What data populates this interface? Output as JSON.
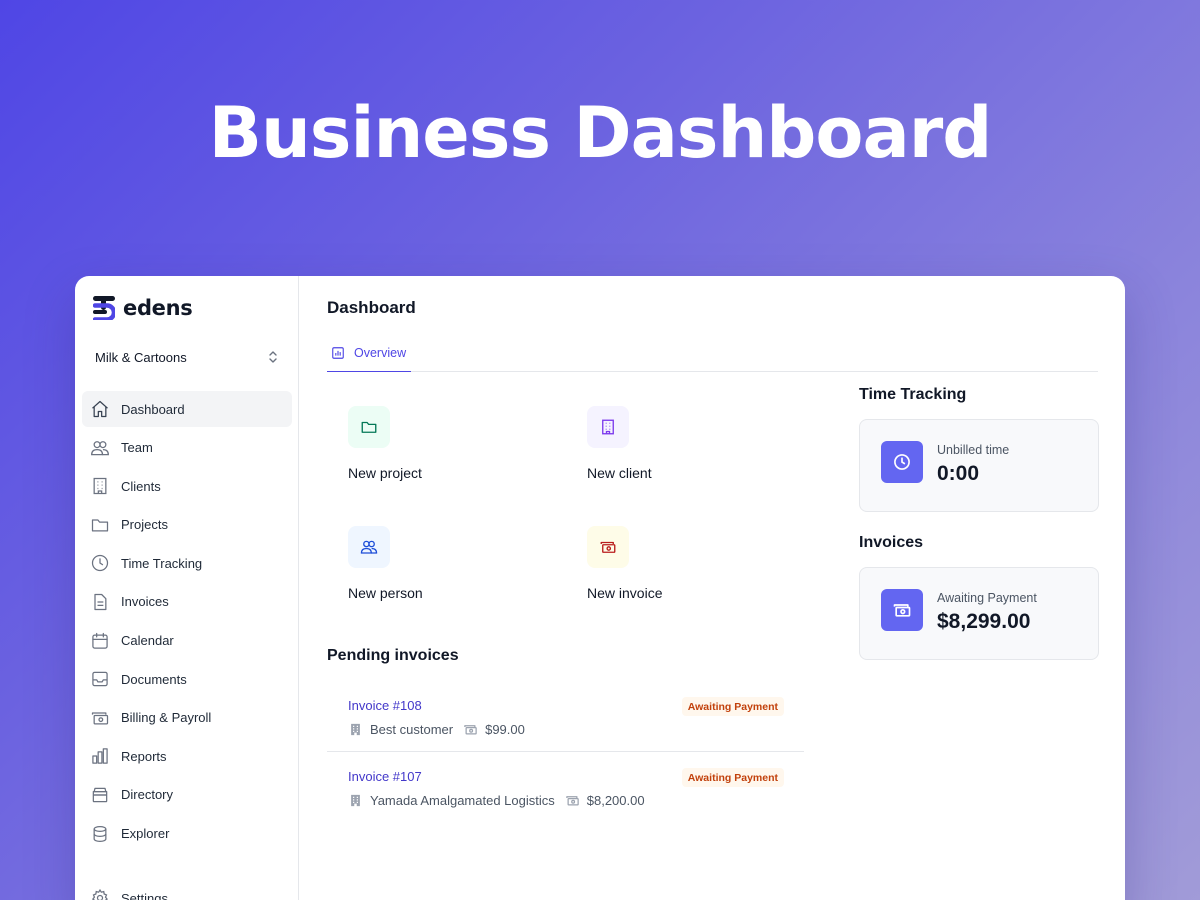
{
  "hero": {
    "title": "Business Dashboard"
  },
  "app": {
    "brand_name": "edens",
    "organization": "Milk & Cartoons"
  },
  "sidebar": {
    "items": [
      {
        "label": "Dashboard",
        "icon": "home-icon",
        "active": true
      },
      {
        "label": "Team",
        "icon": "users-icon"
      },
      {
        "label": "Clients",
        "icon": "building-icon"
      },
      {
        "label": "Projects",
        "icon": "folder-icon"
      },
      {
        "label": "Time Tracking",
        "icon": "clock-icon"
      },
      {
        "label": "Invoices",
        "icon": "document-icon"
      },
      {
        "label": "Calendar",
        "icon": "calendar-icon"
      },
      {
        "label": "Documents",
        "icon": "inbox-icon"
      },
      {
        "label": "Billing & Payroll",
        "icon": "cash-icon"
      },
      {
        "label": "Reports",
        "icon": "chart-bar-icon"
      },
      {
        "label": "Directory",
        "icon": "archive-icon"
      },
      {
        "label": "Explorer",
        "icon": "database-icon"
      }
    ],
    "settings": {
      "label": "Settings",
      "icon": "gear-icon"
    }
  },
  "main": {
    "title": "Dashboard",
    "tabs": [
      {
        "label": "Overview",
        "icon": "chart-bar-icon",
        "active": true
      }
    ],
    "quick_actions": [
      {
        "label": "New project",
        "icon": "folder-icon",
        "bg": "#ecfdf5",
        "color": "#047857"
      },
      {
        "label": "New client",
        "icon": "building-icon",
        "bg": "#f5f3ff",
        "color": "#7c3aed"
      },
      {
        "label": "New person",
        "icon": "users-icon",
        "bg": "#eff6ff",
        "color": "#1d4ed8"
      },
      {
        "label": "New invoice",
        "icon": "cash-icon",
        "bg": "#fefce8",
        "color": "#b91c1c"
      }
    ],
    "pending_invoices": {
      "title": "Pending invoices",
      "items": [
        {
          "number": "Invoice #108",
          "status": "Awaiting Payment",
          "client": "Best customer",
          "amount": "$99.00"
        },
        {
          "number": "Invoice #107",
          "status": "Awaiting Payment",
          "client": "Yamada Amalgamated Logistics",
          "amount": "$8,200.00"
        }
      ]
    },
    "time_tracking": {
      "title": "Time Tracking",
      "label": "Unbilled time",
      "value": "0:00"
    },
    "invoices": {
      "title": "Invoices",
      "label": "Awaiting Payment",
      "value": "$8,299.00"
    }
  },
  "colors": {
    "accent": "#4f46e5",
    "stat_icon_bg": "#6366f1",
    "badge_bg": "#fff7ed",
    "badge_text": "#c2410c"
  }
}
